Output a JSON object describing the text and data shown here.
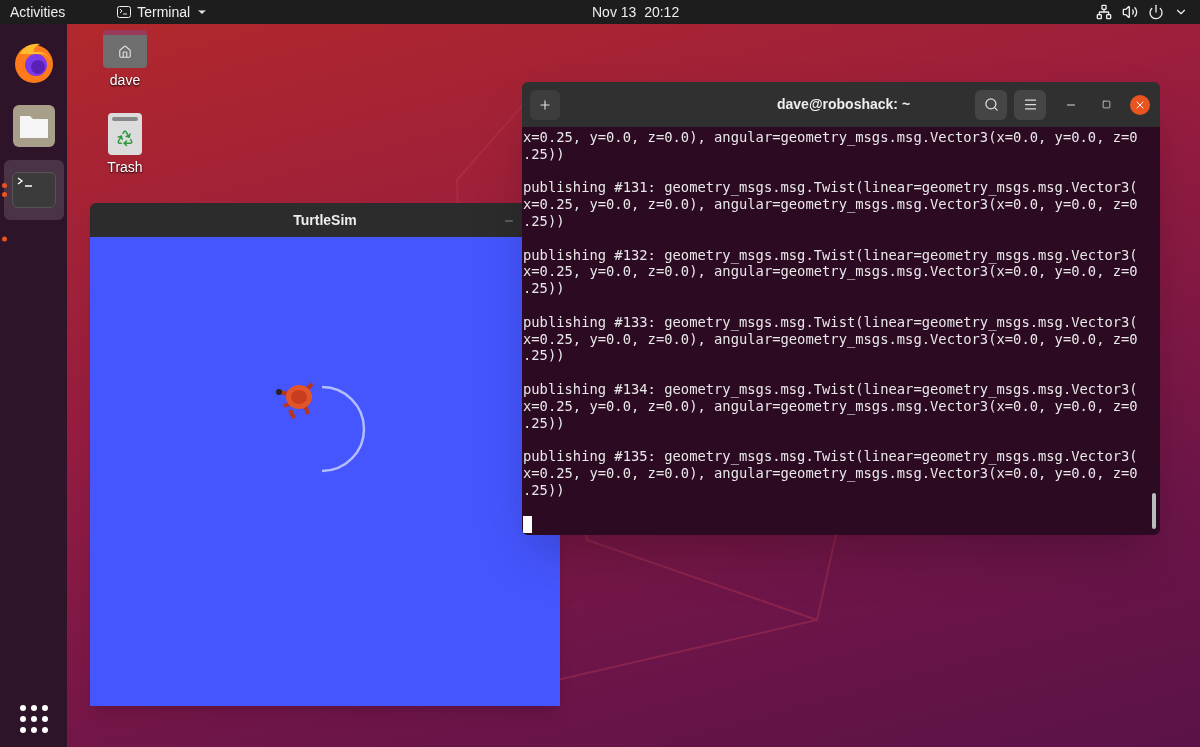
{
  "top_bar": {
    "activities": "Activities",
    "app_menu": "Terminal",
    "clock": "Nov 13  20:12"
  },
  "dock": {
    "items": [
      {
        "kind": "firefox",
        "running": false,
        "focused": false
      },
      {
        "kind": "files",
        "running": false,
        "focused": false
      },
      {
        "kind": "terminal",
        "running": true,
        "focused": true
      },
      {
        "kind": "hidden",
        "running": true,
        "focused": false
      }
    ]
  },
  "desktop_icons": [
    {
      "kind": "home",
      "label": "dave"
    },
    {
      "kind": "trash",
      "label": "Trash"
    }
  ],
  "turtlesim": {
    "title": "TurtleSim"
  },
  "terminal": {
    "title": "dave@roboshack: ~",
    "blocks": [
      [
        "x=0.25, y=0.0, z=0.0), angular=geometry_msgs.msg.Vector3(x=0.0, y=0.0, z=0",
        ".25))"
      ],
      [
        "publishing #131: geometry_msgs.msg.Twist(linear=geometry_msgs.msg.Vector3(",
        "x=0.25, y=0.0, z=0.0), angular=geometry_msgs.msg.Vector3(x=0.0, y=0.0, z=0",
        ".25))"
      ],
      [
        "publishing #132: geometry_msgs.msg.Twist(linear=geometry_msgs.msg.Vector3(",
        "x=0.25, y=0.0, z=0.0), angular=geometry_msgs.msg.Vector3(x=0.0, y=0.0, z=0",
        ".25))"
      ],
      [
        "publishing #133: geometry_msgs.msg.Twist(linear=geometry_msgs.msg.Vector3(",
        "x=0.25, y=0.0, z=0.0), angular=geometry_msgs.msg.Vector3(x=0.0, y=0.0, z=0",
        ".25))"
      ],
      [
        "publishing #134: geometry_msgs.msg.Twist(linear=geometry_msgs.msg.Vector3(",
        "x=0.25, y=0.0, z=0.0), angular=geometry_msgs.msg.Vector3(x=0.0, y=0.0, z=0",
        ".25))"
      ],
      [
        "publishing #135: geometry_msgs.msg.Twist(linear=geometry_msgs.msg.Vector3(",
        "x=0.25, y=0.0, z=0.0), angular=geometry_msgs.msg.Vector3(x=0.0, y=0.0, z=0",
        ".25))"
      ]
    ]
  }
}
